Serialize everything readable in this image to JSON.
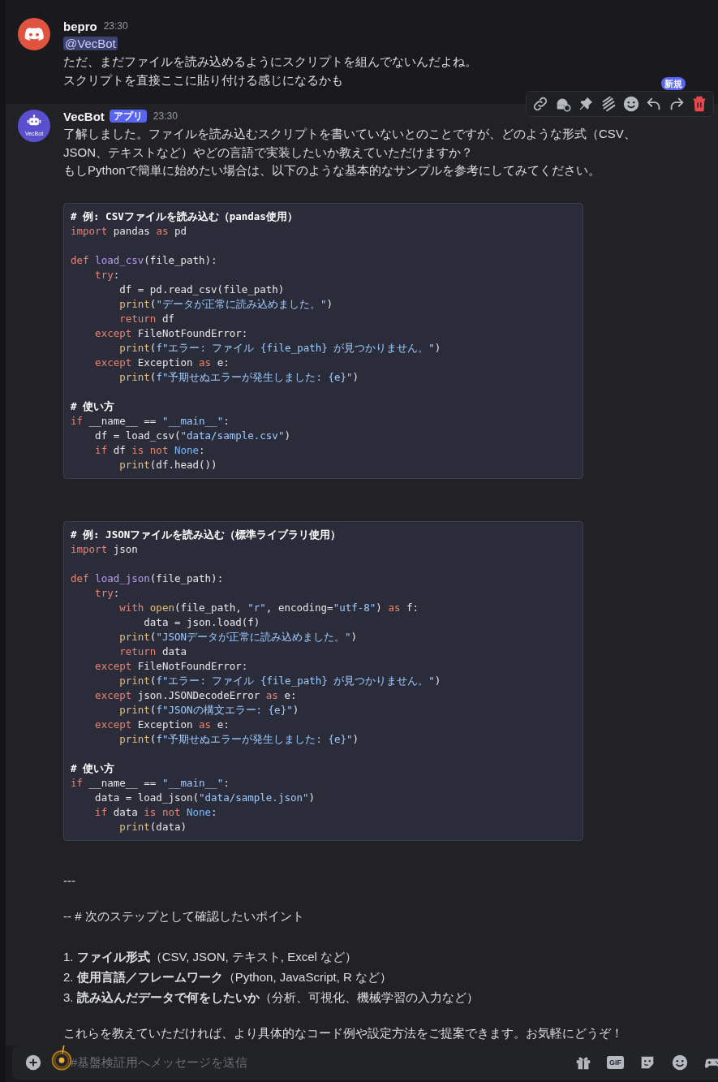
{
  "messages": [
    {
      "author": "bepro",
      "time": "23:30",
      "avatar": {
        "kind": "discord"
      },
      "mention": "@VecBot",
      "blocks": [
        {
          "kind": "text",
          "lines": [
            "ただ、まだファイルを読み込めるようにスクリプトを組んでないんだよね。",
            "スクリプトを直接ここに貼り付ける感じになるかも"
          ]
        }
      ]
    },
    {
      "author": "VecBot",
      "time": "23:30",
      "avatar": {
        "kind": "bot",
        "label": "VecBot"
      },
      "badge": "アプリ",
      "hovered": true,
      "toolbar": {
        "new_badge": "新規"
      },
      "blocks": [
        {
          "kind": "text",
          "lines": [
            "了解しました。ファイルを読み込むスクリプトを書いていないとのことですが、どのような形式（CSV、",
            "JSON、テキストなど）やどの言語で実装したいか教えていただけますか？",
            "もしPythonで簡単に始めたい場合は、以下のような基本的なサンプルを参考にしてみてください。"
          ]
        },
        {
          "kind": "code",
          "sections": [
            [
              [
                {
                  "kind": "cm",
                  "text": "# 例: CSVファイルを読み込む（pandas使用）"
                }
              ],
              [
                {
                  "kind": "kw",
                  "text": "import"
                },
                {
                  "kind": "tx",
                  "text": " pandas "
                },
                {
                  "kind": "kw",
                  "text": "as"
                },
                {
                  "kind": "tx",
                  "text": " pd"
                }
              ]
            ],
            [
              [
                {
                  "kind": "kw",
                  "text": "def "
                },
                {
                  "kind": "fn",
                  "text": "load_csv"
                },
                {
                  "kind": "tx",
                  "text": "(file_path):"
                }
              ],
              [
                {
                  "kind": "kw",
                  "text": "    try"
                },
                {
                  "kind": "tx",
                  "text": ":"
                }
              ],
              [
                {
                  "kind": "tx",
                  "text": "        df = pd.read_csv(file_path)"
                }
              ],
              [
                {
                  "kind": "bi",
                  "text": "        print"
                },
                {
                  "kind": "tx",
                  "text": "("
                },
                {
                  "kind": "str",
                  "text": "\"データが正常に読み込めました。\""
                },
                {
                  "kind": "tx",
                  "text": ")"
                }
              ],
              [
                {
                  "kind": "kw",
                  "text": "        return"
                },
                {
                  "kind": "tx",
                  "text": " df"
                }
              ],
              [
                {
                  "kind": "kw",
                  "text": "    except"
                },
                {
                  "kind": "tx",
                  "text": " FileNotFoundError:"
                }
              ],
              [
                {
                  "kind": "bi",
                  "text": "        print"
                },
                {
                  "kind": "tx",
                  "text": "("
                },
                {
                  "kind": "str",
                  "text": "f\"エラー: ファイル {file_path} が見つかりません。\""
                },
                {
                  "kind": "tx",
                  "text": ")"
                }
              ],
              [
                {
                  "kind": "kw",
                  "text": "    except"
                },
                {
                  "kind": "tx",
                  "text": " Exception "
                },
                {
                  "kind": "kw",
                  "text": "as"
                },
                {
                  "kind": "tx",
                  "text": " e:"
                }
              ],
              [
                {
                  "kind": "bi",
                  "text": "        print"
                },
                {
                  "kind": "tx",
                  "text": "("
                },
                {
                  "kind": "str",
                  "text": "f\"予期せぬエラーが発生しました: {e}\""
                },
                {
                  "kind": "tx",
                  "text": ")"
                }
              ]
            ],
            [
              [
                {
                  "kind": "cm",
                  "text": "# 使い方"
                }
              ],
              [
                {
                  "kind": "kw",
                  "text": "if"
                },
                {
                  "kind": "tx",
                  "text": " __name__ == "
                },
                {
                  "kind": "str",
                  "text": "\"__main__\""
                },
                {
                  "kind": "tx",
                  "text": ":"
                }
              ],
              [
                {
                  "kind": "tx",
                  "text": "    df = load_csv("
                },
                {
                  "kind": "str",
                  "text": "\"data/sample.csv\""
                },
                {
                  "kind": "tx",
                  "text": ")"
                }
              ],
              [
                {
                  "kind": "kw",
                  "text": "    if"
                },
                {
                  "kind": "tx",
                  "text": " df "
                },
                {
                  "kind": "kw",
                  "text": "is not "
                },
                {
                  "kind": "const",
                  "text": "None"
                },
                {
                  "kind": "tx",
                  "text": ":"
                }
              ],
              [
                {
                  "kind": "bi",
                  "text": "        print"
                },
                {
                  "kind": "tx",
                  "text": "(df.head())"
                }
              ]
            ]
          ]
        },
        {
          "kind": "code",
          "sections": [
            [
              [
                {
                  "kind": "cm",
                  "text": "# 例: JSONファイルを読み込む（標準ライブラリ使用）"
                }
              ],
              [
                {
                  "kind": "kw",
                  "text": "import"
                },
                {
                  "kind": "tx",
                  "text": " json"
                }
              ]
            ],
            [
              [
                {
                  "kind": "kw",
                  "text": "def "
                },
                {
                  "kind": "fn",
                  "text": "load_json"
                },
                {
                  "kind": "tx",
                  "text": "(file_path):"
                }
              ],
              [
                {
                  "kind": "kw",
                  "text": "    try"
                },
                {
                  "kind": "tx",
                  "text": ":"
                }
              ],
              [
                {
                  "kind": "kw",
                  "text": "        with "
                },
                {
                  "kind": "bi",
                  "text": "open"
                },
                {
                  "kind": "tx",
                  "text": "(file_path, "
                },
                {
                  "kind": "str",
                  "text": "\"r\""
                },
                {
                  "kind": "tx",
                  "text": ", encoding="
                },
                {
                  "kind": "str",
                  "text": "\"utf-8\""
                },
                {
                  "kind": "tx",
                  "text": ") "
                },
                {
                  "kind": "kw",
                  "text": "as"
                },
                {
                  "kind": "tx",
                  "text": " f:"
                }
              ],
              [
                {
                  "kind": "tx",
                  "text": "            data = json.load(f)"
                }
              ],
              [
                {
                  "kind": "bi",
                  "text": "        print"
                },
                {
                  "kind": "tx",
                  "text": "("
                },
                {
                  "kind": "str",
                  "text": "\"JSONデータが正常に読み込めました。\""
                },
                {
                  "kind": "tx",
                  "text": ")"
                }
              ],
              [
                {
                  "kind": "kw",
                  "text": "        return"
                },
                {
                  "kind": "tx",
                  "text": " data"
                }
              ],
              [
                {
                  "kind": "kw",
                  "text": "    except"
                },
                {
                  "kind": "tx",
                  "text": " FileNotFoundError:"
                }
              ],
              [
                {
                  "kind": "bi",
                  "text": "        print"
                },
                {
                  "kind": "tx",
                  "text": "("
                },
                {
                  "kind": "str",
                  "text": "f\"エラー: ファイル {file_path} が見つかりません。\""
                },
                {
                  "kind": "tx",
                  "text": ")"
                }
              ],
              [
                {
                  "kind": "kw",
                  "text": "    except"
                },
                {
                  "kind": "tx",
                  "text": " json.JSONDecodeError "
                },
                {
                  "kind": "kw",
                  "text": "as"
                },
                {
                  "kind": "tx",
                  "text": " e:"
                }
              ],
              [
                {
                  "kind": "bi",
                  "text": "        print"
                },
                {
                  "kind": "tx",
                  "text": "("
                },
                {
                  "kind": "str",
                  "text": "f\"JSONの構文エラー: {e}\""
                },
                {
                  "kind": "tx",
                  "text": ")"
                }
              ],
              [
                {
                  "kind": "kw",
                  "text": "    except"
                },
                {
                  "kind": "tx",
                  "text": " Exception "
                },
                {
                  "kind": "kw",
                  "text": "as"
                },
                {
                  "kind": "tx",
                  "text": " e:"
                }
              ],
              [
                {
                  "kind": "bi",
                  "text": "        print"
                },
                {
                  "kind": "tx",
                  "text": "("
                },
                {
                  "kind": "str",
                  "text": "f\"予期せぬエラーが発生しました: {e}\""
                },
                {
                  "kind": "tx",
                  "text": ")"
                }
              ]
            ],
            [
              [
                {
                  "kind": "cm",
                  "text": "# 使い方"
                }
              ],
              [
                {
                  "kind": "kw",
                  "text": "if"
                },
                {
                  "kind": "tx",
                  "text": " __name__ == "
                },
                {
                  "kind": "str",
                  "text": "\"__main__\""
                },
                {
                  "kind": "tx",
                  "text": ":"
                }
              ],
              [
                {
                  "kind": "tx",
                  "text": "    data = load_json("
                },
                {
                  "kind": "str",
                  "text": "\"data/sample.json\""
                },
                {
                  "kind": "tx",
                  "text": ")"
                }
              ],
              [
                {
                  "kind": "kw",
                  "text": "    if"
                },
                {
                  "kind": "tx",
                  "text": " data "
                },
                {
                  "kind": "kw",
                  "text": "is not "
                },
                {
                  "kind": "const",
                  "text": "None"
                },
                {
                  "kind": "tx",
                  "text": ":"
                }
              ],
              [
                {
                  "kind": "bi",
                  "text": "        print"
                },
                {
                  "kind": "tx",
                  "text": "(data)"
                }
              ]
            ]
          ]
        },
        {
          "kind": "rule",
          "text": "---"
        },
        {
          "kind": "heading",
          "text": "-- # 次のステップとして確認したいポイント"
        },
        {
          "kind": "list",
          "items": [
            "1. **ファイル形式**（CSV, JSON, テキスト, Excel など）",
            "2. **使用言語／フレームワーク**（Python, JavaScript, R など）",
            "3. **読み込んだデータで何をしたいか**（分析、可視化、機械学習の入力など）"
          ]
        },
        {
          "kind": "final",
          "lines": [
            "これらを教えていただければ、より具体的なコード例や設定方法をご提案できます。お気軽にどうぞ！"
          ]
        }
      ]
    }
  ],
  "composer": {
    "placeholder": "#基盤検証用へメッセージを送信",
    "gif_label": "GIF"
  }
}
